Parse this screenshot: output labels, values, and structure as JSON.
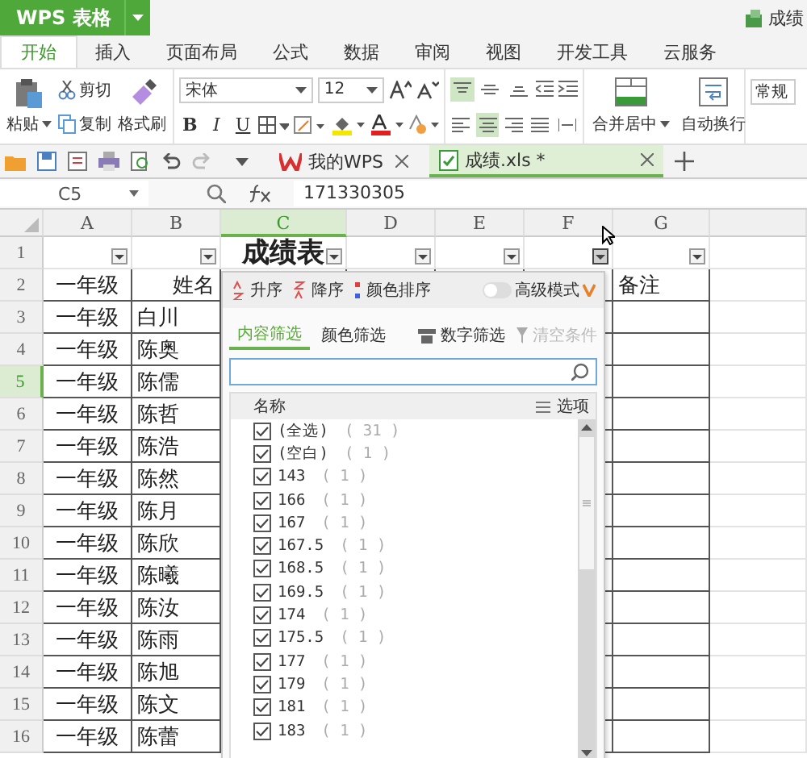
{
  "app_menu": {
    "label": "WPS 表格"
  },
  "title_doc": "成绩",
  "ribbon_tabs": [
    {
      "label": "开始",
      "selected": true
    },
    {
      "label": "插入",
      "selected": false
    },
    {
      "label": "页面布局",
      "selected": false
    },
    {
      "label": "公式",
      "selected": false
    },
    {
      "label": "数据",
      "selected": false
    },
    {
      "label": "审阅",
      "selected": false
    },
    {
      "label": "视图",
      "selected": false
    },
    {
      "label": "开发工具",
      "selected": false
    },
    {
      "label": "云服务",
      "selected": false
    }
  ],
  "ribbon": {
    "paste": "粘贴",
    "cut": "剪切",
    "copy": "复制",
    "format_painter": "格式刷",
    "font": "宋体",
    "font_size": "12",
    "bold": "B",
    "italic": "I",
    "underline": "U",
    "merge": "合并居中",
    "wrap": "自动换行",
    "number_format": "常规"
  },
  "vertical_align": [
    {
      "selected": true
    },
    {
      "selected": false
    },
    {
      "selected": false
    }
  ],
  "horizontal_align": [
    {
      "selected": false
    },
    {
      "selected": true
    },
    {
      "selected": false
    },
    {
      "selected": false
    },
    {
      "selected": false
    }
  ],
  "doc_tabs": [
    {
      "label": "我的WPS",
      "selected": false
    },
    {
      "label": "成绩.xls *",
      "selected": true
    }
  ],
  "formula_bar": {
    "cell": "C5",
    "value": "171330305"
  },
  "columns": [
    {
      "label": "A",
      "selected": false,
      "filter_active": false
    },
    {
      "label": "B",
      "selected": false,
      "filter_active": false
    },
    {
      "label": "C",
      "selected": true,
      "filter_active": false
    },
    {
      "label": "D",
      "selected": false,
      "filter_active": false
    },
    {
      "label": "E",
      "selected": false,
      "filter_active": false
    },
    {
      "label": "F",
      "selected": false,
      "filter_active": true
    },
    {
      "label": "G",
      "selected": false,
      "filter_active": false
    }
  ],
  "rows": [
    {
      "label": "1",
      "selected": false,
      "title": "成绩表"
    },
    {
      "label": "2",
      "selected": false,
      "grade": "一年级",
      "name": "姓名",
      "note": "备注"
    },
    {
      "label": "3",
      "selected": false,
      "grade": "一年级",
      "name": "白川"
    },
    {
      "label": "4",
      "selected": false,
      "grade": "一年级",
      "name": "陈奥"
    },
    {
      "label": "5",
      "selected": true,
      "grade": "一年级",
      "name": "陈儒"
    },
    {
      "label": "6",
      "selected": false,
      "grade": "一年级",
      "name": "陈哲"
    },
    {
      "label": "7",
      "selected": false,
      "grade": "一年级",
      "name": "陈浩"
    },
    {
      "label": "8",
      "selected": false,
      "grade": "一年级",
      "name": "陈然"
    },
    {
      "label": "9",
      "selected": false,
      "grade": "一年级",
      "name": "陈月"
    },
    {
      "label": "10",
      "selected": false,
      "grade": "一年级",
      "name": "陈欣"
    },
    {
      "label": "11",
      "selected": false,
      "grade": "一年级",
      "name": "陈曦"
    },
    {
      "label": "12",
      "selected": false,
      "grade": "一年级",
      "name": "陈汝"
    },
    {
      "label": "13",
      "selected": false,
      "grade": "一年级",
      "name": "陈雨"
    },
    {
      "label": "14",
      "selected": false,
      "grade": "一年级",
      "name": "陈旭"
    },
    {
      "label": "15",
      "selected": false,
      "grade": "一年级",
      "name": "陈文"
    },
    {
      "label": "16",
      "selected": false,
      "grade": "一年级",
      "name": "陈蕾"
    }
  ],
  "filter_panel": {
    "sort": [
      "升序",
      "降序",
      "颜色排序"
    ],
    "advanced_mode": {
      "label": "高级模式",
      "on": false
    },
    "tabs": [
      {
        "label": "内容筛选",
        "selected": true
      },
      {
        "label": "颜色筛选",
        "selected": false
      }
    ],
    "number_filter": "数字筛选",
    "clear": {
      "label": "清空条件",
      "disabled": true
    },
    "list_header": "名称",
    "options": "选项",
    "items": [
      {
        "label": "(全选)",
        "count": "( 31 )",
        "checked": true
      },
      {
        "label": "(空白)",
        "count": "( 1 )",
        "checked": true
      },
      {
        "label": "143",
        "count": "( 1 )",
        "checked": true
      },
      {
        "label": "166",
        "count": "( 1 )",
        "checked": true
      },
      {
        "label": "167",
        "count": "( 1 )",
        "checked": true
      },
      {
        "label": "167.5",
        "count": "( 1 )",
        "checked": true
      },
      {
        "label": "168.5",
        "count": "( 1 )",
        "checked": true
      },
      {
        "label": "169.5",
        "count": "( 1 )",
        "checked": true
      },
      {
        "label": "174",
        "count": "( 1 )",
        "checked": true
      },
      {
        "label": "175.5",
        "count": "( 1 )",
        "checked": true
      },
      {
        "label": "177",
        "count": "( 1 )",
        "checked": true
      },
      {
        "label": "179",
        "count": "( 1 )",
        "checked": true
      },
      {
        "label": "181",
        "count": "( 1 )",
        "checked": true
      },
      {
        "label": "183",
        "count": "( 1 )",
        "checked": true
      }
    ]
  }
}
